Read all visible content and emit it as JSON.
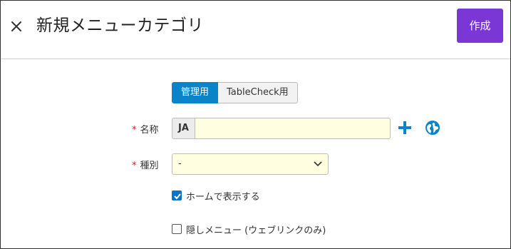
{
  "header": {
    "title": "新規メニューカテゴリ",
    "create_label": "作成",
    "close_icon": "close-icon"
  },
  "audience_toggle": {
    "options": [
      "管理用",
      "TableCheck用"
    ],
    "selected": "管理用"
  },
  "form": {
    "name": {
      "required_mark": "*",
      "label": "名称",
      "language": "JA",
      "value": "",
      "add_icon": "plus-icon",
      "translate_icon": "globe-icon"
    },
    "type": {
      "required_mark": "*",
      "label": "種別",
      "value": "-"
    },
    "show_on_home": {
      "label": "ホームで表示する",
      "checked": true
    },
    "hidden_menu": {
      "label": "隠しメニュー (ウェブリンクのみ)",
      "checked": false
    }
  },
  "colors": {
    "primary_button": "#7b36d6",
    "toggle_active": "#0a84c8",
    "input_background": "#fffee0",
    "required": "#cc2222",
    "icon_blue": "#0a84c8"
  }
}
